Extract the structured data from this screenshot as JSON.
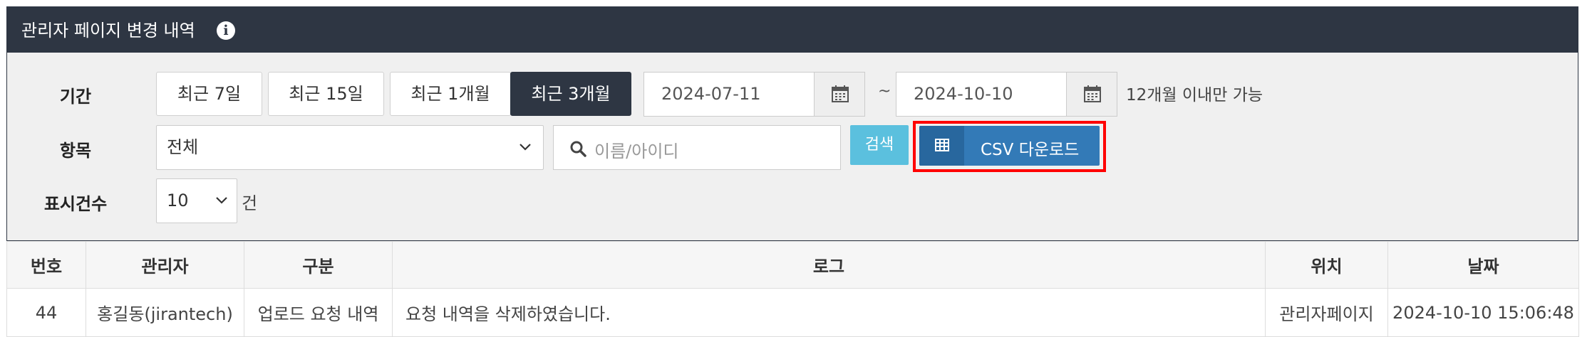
{
  "panel": {
    "title": "관리자 페이지 변경 내역",
    "info_icon": "info-circle-icon"
  },
  "filters": {
    "period_label": "기간",
    "period_buttons": [
      "최근 7일",
      "최근 15일",
      "최근 1개월",
      "최근 3개월"
    ],
    "active_period": "최근 3개월",
    "start_date": "2024-07-11",
    "separator": "~",
    "end_date": "2024-10-10",
    "calendar_icon": "calendar-icon",
    "range_note": "12개월 이내만 가능",
    "item_label": "항목",
    "item_select_value": "전체",
    "search_placeholder": "이름/아이디",
    "search_icon": "search-icon",
    "search_button": "검색",
    "csv_button": "CSV 다운로드",
    "csv_icon": "table-grid-icon",
    "count_label": "표시건수",
    "count_value": "10",
    "count_unit": "건"
  },
  "colors": {
    "header_bg": "#2e3643",
    "search_button": "#5bc0de",
    "csv_button": "#337ab7",
    "highlight_box": "#ff0000"
  },
  "table": {
    "columns": [
      "번호",
      "관리자",
      "구분",
      "로그",
      "위치",
      "날짜"
    ],
    "rows": [
      [
        "44",
        "홍길동(jirantech)",
        "업로드 요청 내역",
        "요청 내역을 삭제하였습니다.",
        "관리자페이지",
        "2024-10-10 15:06:48"
      ]
    ]
  }
}
